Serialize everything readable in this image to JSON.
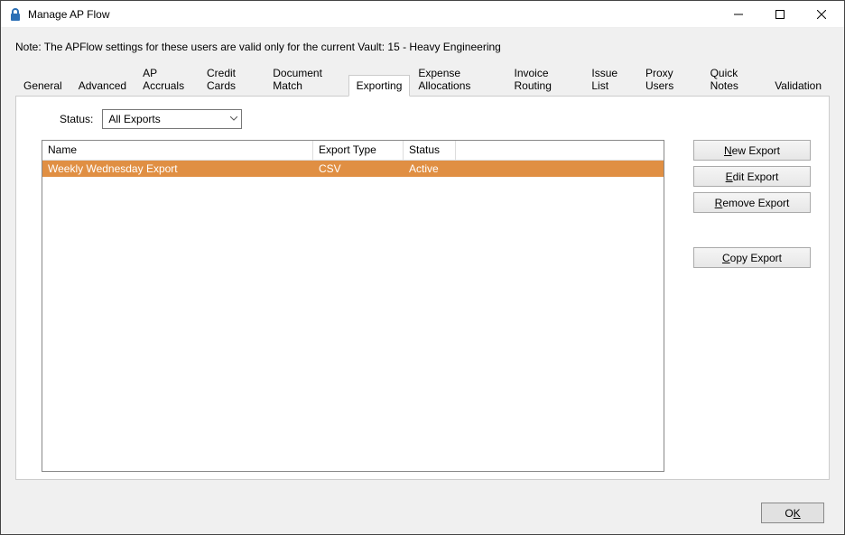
{
  "window": {
    "title": "Manage AP Flow"
  },
  "note": "Note:  The APFlow settings for these users are valid only for the current Vault: 15 - Heavy Engineering",
  "tabs": {
    "items": [
      {
        "label": "General"
      },
      {
        "label": "Advanced"
      },
      {
        "label": "AP Accruals"
      },
      {
        "label": "Credit Cards"
      },
      {
        "label": "Document Match"
      },
      {
        "label": "Exporting"
      },
      {
        "label": "Expense Allocations"
      },
      {
        "label": "Invoice Routing"
      },
      {
        "label": "Issue List"
      },
      {
        "label": "Proxy Users"
      },
      {
        "label": "Quick Notes"
      },
      {
        "label": "Validation"
      }
    ],
    "active": "Exporting"
  },
  "filter": {
    "label": "Status:",
    "selected": "All Exports"
  },
  "table": {
    "headers": {
      "name": "Name",
      "type": "Export Type",
      "status": "Status"
    },
    "rows": [
      {
        "name": "Weekly Wednesday Export",
        "type": "CSV",
        "status": "Active"
      }
    ]
  },
  "buttons": {
    "new": {
      "pre": "",
      "u": "N",
      "post": "ew Export"
    },
    "edit": {
      "pre": "",
      "u": "E",
      "post": "dit Export"
    },
    "remove": {
      "pre": "",
      "u": "R",
      "post": "emove Export"
    },
    "copy": {
      "pre": "",
      "u": "C",
      "post": "opy Export"
    },
    "ok": {
      "pre": "O",
      "u": "K",
      "post": ""
    }
  }
}
